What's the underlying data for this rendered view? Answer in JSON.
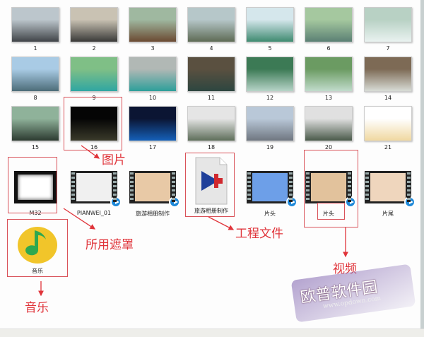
{
  "photos": [
    {
      "label": "1",
      "c": [
        "#bcc6cc",
        "#404448"
      ]
    },
    {
      "label": "2",
      "c": [
        "#c9c2b3",
        "#3a3a38"
      ]
    },
    {
      "label": "3",
      "c": [
        "#9fb8a0",
        "#6b4a32"
      ]
    },
    {
      "label": "4",
      "c": [
        "#b6c7c9",
        "#5e6b55"
      ]
    },
    {
      "label": "5",
      "c": [
        "#d5e7ec",
        "#3f8a70"
      ]
    },
    {
      "label": "6",
      "c": [
        "#a5c89f",
        "#5b8074"
      ]
    },
    {
      "label": "7",
      "c": [
        "#b8d1c4",
        "#e9f2f0"
      ]
    },
    {
      "label": "8",
      "c": [
        "#a9cbe5",
        "#4c6c78"
      ]
    },
    {
      "label": "9",
      "c": [
        "#7fbf86",
        "#2fa6a2"
      ]
    },
    {
      "label": "10",
      "c": [
        "#b1b8b5",
        "#2d9f9a"
      ]
    },
    {
      "label": "11",
      "c": [
        "#5a5040",
        "#2d4640"
      ]
    },
    {
      "label": "12",
      "c": [
        "#3c7a55",
        "#b7d4c8"
      ]
    },
    {
      "label": "13",
      "c": [
        "#6b9b62",
        "#c1dccc"
      ]
    },
    {
      "label": "14",
      "c": [
        "#7d6a55",
        "#d8dcd6"
      ]
    },
    {
      "label": "15",
      "c": [
        "#8fb29a",
        "#2c3a30"
      ]
    },
    {
      "label": "16",
      "c": [
        "#050505",
        "#3a3a2a"
      ]
    },
    {
      "label": "17",
      "c": [
        "#0b1533",
        "#1560b8"
      ]
    },
    {
      "label": "18",
      "c": [
        "#e5e5e5",
        "#5e6e5a"
      ]
    },
    {
      "label": "19",
      "c": [
        "#b9c8d8",
        "#6f7680"
      ]
    },
    {
      "label": "20",
      "c": [
        "#e0e0e0",
        "#4a5a4a"
      ]
    },
    {
      "label": "21",
      "c": [
        "#ffffff",
        "#f0d8a0"
      ]
    }
  ],
  "files": [
    {
      "label": "M32",
      "type": "mask"
    },
    {
      "label": "PIANWEI_01",
      "type": "video",
      "bg": "#f0f0f0"
    },
    {
      "label": "旅游相册制作",
      "type": "video",
      "bg": "#e8c9a6"
    },
    {
      "label": "旅游相册制作",
      "type": "project"
    },
    {
      "label": "片头",
      "type": "video",
      "bg": "#6d9fe8"
    },
    {
      "label": "片头",
      "type": "video",
      "bg": "#e2c29c"
    },
    {
      "label": "片尾",
      "type": "video",
      "bg": "#efd6bd"
    }
  ],
  "music": {
    "label": "音乐"
  },
  "annotations": {
    "pictures": "图片",
    "masks": "所用遮罩",
    "project": "工程文件",
    "video": "视频",
    "music": "音乐"
  },
  "watermark": {
    "name": "欧普软件园",
    "url": "www.opdown.com"
  },
  "colors": {
    "annotation": "#e0343a",
    "play": "#1e88d8"
  }
}
